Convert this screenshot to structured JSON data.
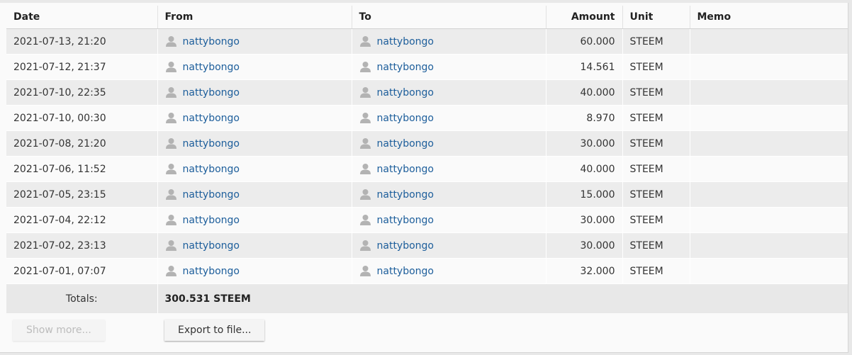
{
  "table": {
    "columns": [
      "Date",
      "From",
      "To",
      "Amount",
      "Unit",
      "Memo"
    ],
    "rows": [
      {
        "date": "2021-07-13, 21:20",
        "from": "nattybongo",
        "to": "nattybongo",
        "amount": "60.000",
        "unit": "STEEM",
        "memo": ""
      },
      {
        "date": "2021-07-12, 21:37",
        "from": "nattybongo",
        "to": "nattybongo",
        "amount": "14.561",
        "unit": "STEEM",
        "memo": ""
      },
      {
        "date": "2021-07-10, 22:35",
        "from": "nattybongo",
        "to": "nattybongo",
        "amount": "40.000",
        "unit": "STEEM",
        "memo": ""
      },
      {
        "date": "2021-07-10, 00:30",
        "from": "nattybongo",
        "to": "nattybongo",
        "amount": "8.970",
        "unit": "STEEM",
        "memo": ""
      },
      {
        "date": "2021-07-08, 21:20",
        "from": "nattybongo",
        "to": "nattybongo",
        "amount": "30.000",
        "unit": "STEEM",
        "memo": ""
      },
      {
        "date": "2021-07-06, 11:52",
        "from": "nattybongo",
        "to": "nattybongo",
        "amount": "40.000",
        "unit": "STEEM",
        "memo": ""
      },
      {
        "date": "2021-07-05, 23:15",
        "from": "nattybongo",
        "to": "nattybongo",
        "amount": "15.000",
        "unit": "STEEM",
        "memo": ""
      },
      {
        "date": "2021-07-04, 22:12",
        "from": "nattybongo",
        "to": "nattybongo",
        "amount": "30.000",
        "unit": "STEEM",
        "memo": ""
      },
      {
        "date": "2021-07-02, 23:13",
        "from": "nattybongo",
        "to": "nattybongo",
        "amount": "30.000",
        "unit": "STEEM",
        "memo": ""
      },
      {
        "date": "2021-07-01, 07:07",
        "from": "nattybongo",
        "to": "nattybongo",
        "amount": "32.000",
        "unit": "STEEM",
        "memo": ""
      }
    ],
    "user_icon": "user-silhouette-icon"
  },
  "totals": {
    "label": "Totals:",
    "value": "300.531 STEEM"
  },
  "actions": {
    "show_more_label": "Show more...",
    "export_label": "Export to file..."
  },
  "colors": {
    "link": "#1d5e9b",
    "row_alt": "#ececec",
    "row_plain": "#fafafa",
    "icon": "#b3b3b3"
  }
}
